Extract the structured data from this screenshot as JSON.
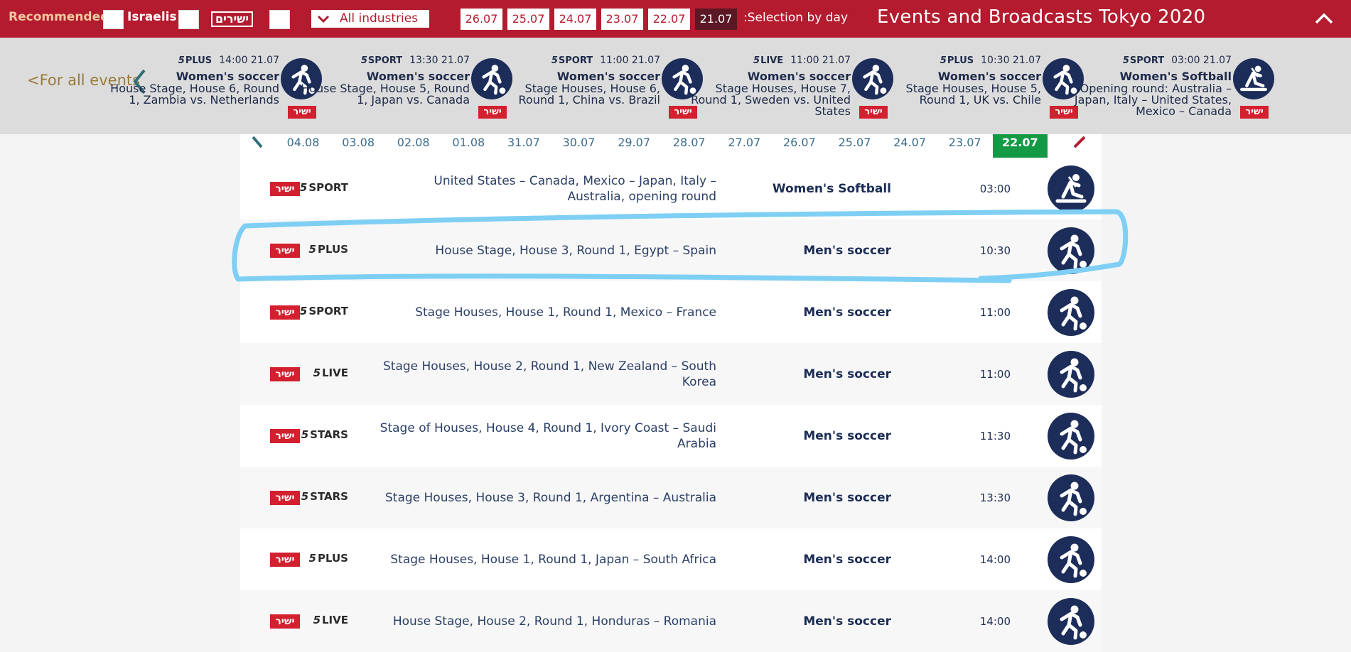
{
  "header": {
    "recommended_label": "Recommended",
    "israelis_label": "Israelis",
    "yesh_label": "ישירים",
    "industries_label": "All industries",
    "days": [
      "26.07",
      "25.07",
      "24.07",
      "23.07",
      "22.07",
      "21.07"
    ],
    "active_day": "21.07",
    "selection_label": ":Selection by day",
    "title": "Events and Broadcasts Tokyo 2020",
    "accent_color": "#b41b2e"
  },
  "carousel": {
    "all_events_label": "<For all events",
    "cards": [
      {
        "channel": "PLUS",
        "time": "14:00 21.07",
        "sport": "Women's soccer",
        "desc": "House Stage, House 6, Round 1, Zambia vs. Netherlands",
        "live": "ישיר",
        "icon": "soccer-icon"
      },
      {
        "channel": "SPORT",
        "time": "13:30 21.07",
        "sport": "Women's soccer",
        "desc": "House Stage, House 5, Round 1, Japan vs. Canada",
        "live": "ישיר",
        "icon": "soccer-icon"
      },
      {
        "channel": "SPORT",
        "time": "11:00 21.07",
        "sport": "Women's soccer",
        "desc": "Stage Houses, House 6, Round 1, China vs. Brazil",
        "live": "ישיר",
        "icon": "soccer-icon"
      },
      {
        "channel": "LIVE",
        "time": "11:00 21.07",
        "sport": "Women's soccer",
        "desc": "Stage Houses, House 7, Round 1, Sweden vs. United States",
        "live": "ישיר",
        "icon": "soccer-icon"
      },
      {
        "channel": "PLUS",
        "time": "10:30 21.07",
        "sport": "Women's soccer",
        "desc": "Stage Houses, House 5, Round 1, UK vs. Chile",
        "live": "ישיר",
        "icon": "soccer-icon"
      },
      {
        "channel": "SPORT",
        "time": "03:00 21.07",
        "sport": "Women's Softball",
        "desc": "Opening round: Australia – Japan, Italy – United States, Mexico – Canada",
        "live": "ישיר",
        "icon": "softball-icon"
      }
    ]
  },
  "dates": {
    "items": [
      "04.08",
      "03.08",
      "02.08",
      "01.08",
      "31.07",
      "30.07",
      "29.07",
      "28.07",
      "27.07",
      "26.07",
      "25.07",
      "24.07",
      "23.07",
      "22.07"
    ],
    "active": "22.07",
    "active_color": "#149a44"
  },
  "events": [
    {
      "live": "ישיר",
      "channel": "SPORT",
      "desc": "United States – Canada, Mexico – Japan, Italy – Australia, opening round",
      "sport": "Women's Softball",
      "time": "03:00",
      "icon": "softball-icon"
    },
    {
      "live": "ישיר",
      "channel": "PLUS",
      "desc": "House Stage, House 3, Round 1, Egypt – Spain",
      "sport": "Men's soccer",
      "time": "10:30",
      "icon": "soccer-icon"
    },
    {
      "live": "ישיר",
      "channel": "SPORT",
      "desc": "Stage Houses, House 1, Round 1, Mexico – France",
      "sport": "Men's soccer",
      "time": "11:00",
      "icon": "soccer-icon"
    },
    {
      "live": "ישיר",
      "channel": "LIVE",
      "desc": "Stage Houses, House 2, Round 1, New Zealand – South Korea",
      "sport": "Men's soccer",
      "time": "11:00",
      "icon": "soccer-icon"
    },
    {
      "live": "ישיר",
      "channel": "STARS",
      "desc": "Stage of Houses, House 4, Round 1, Ivory Coast – Saudi Arabia",
      "sport": "Men's soccer",
      "time": "11:30",
      "icon": "soccer-icon"
    },
    {
      "live": "ישיר",
      "channel": "STARS",
      "desc": "Stage Houses, House 3, Round 1, Argentina – Australia",
      "sport": "Men's soccer",
      "time": "13:30",
      "icon": "soccer-icon"
    },
    {
      "live": "ישיר",
      "channel": "PLUS",
      "desc": "Stage Houses, House 1, Round 1, Japan – South Africa",
      "sport": "Men's soccer",
      "time": "14:00",
      "icon": "soccer-icon"
    },
    {
      "live": "ישיר",
      "channel": "LIVE",
      "desc": "House Stage, House 2, Round 1, Honduras – Romania",
      "sport": "Men's soccer",
      "time": "14:00",
      "icon": "soccer-icon"
    }
  ],
  "annotation": {
    "highlighted_event": "House Stage, House 3, Round 1, Egypt – Spain",
    "color": "#7fcff5"
  }
}
